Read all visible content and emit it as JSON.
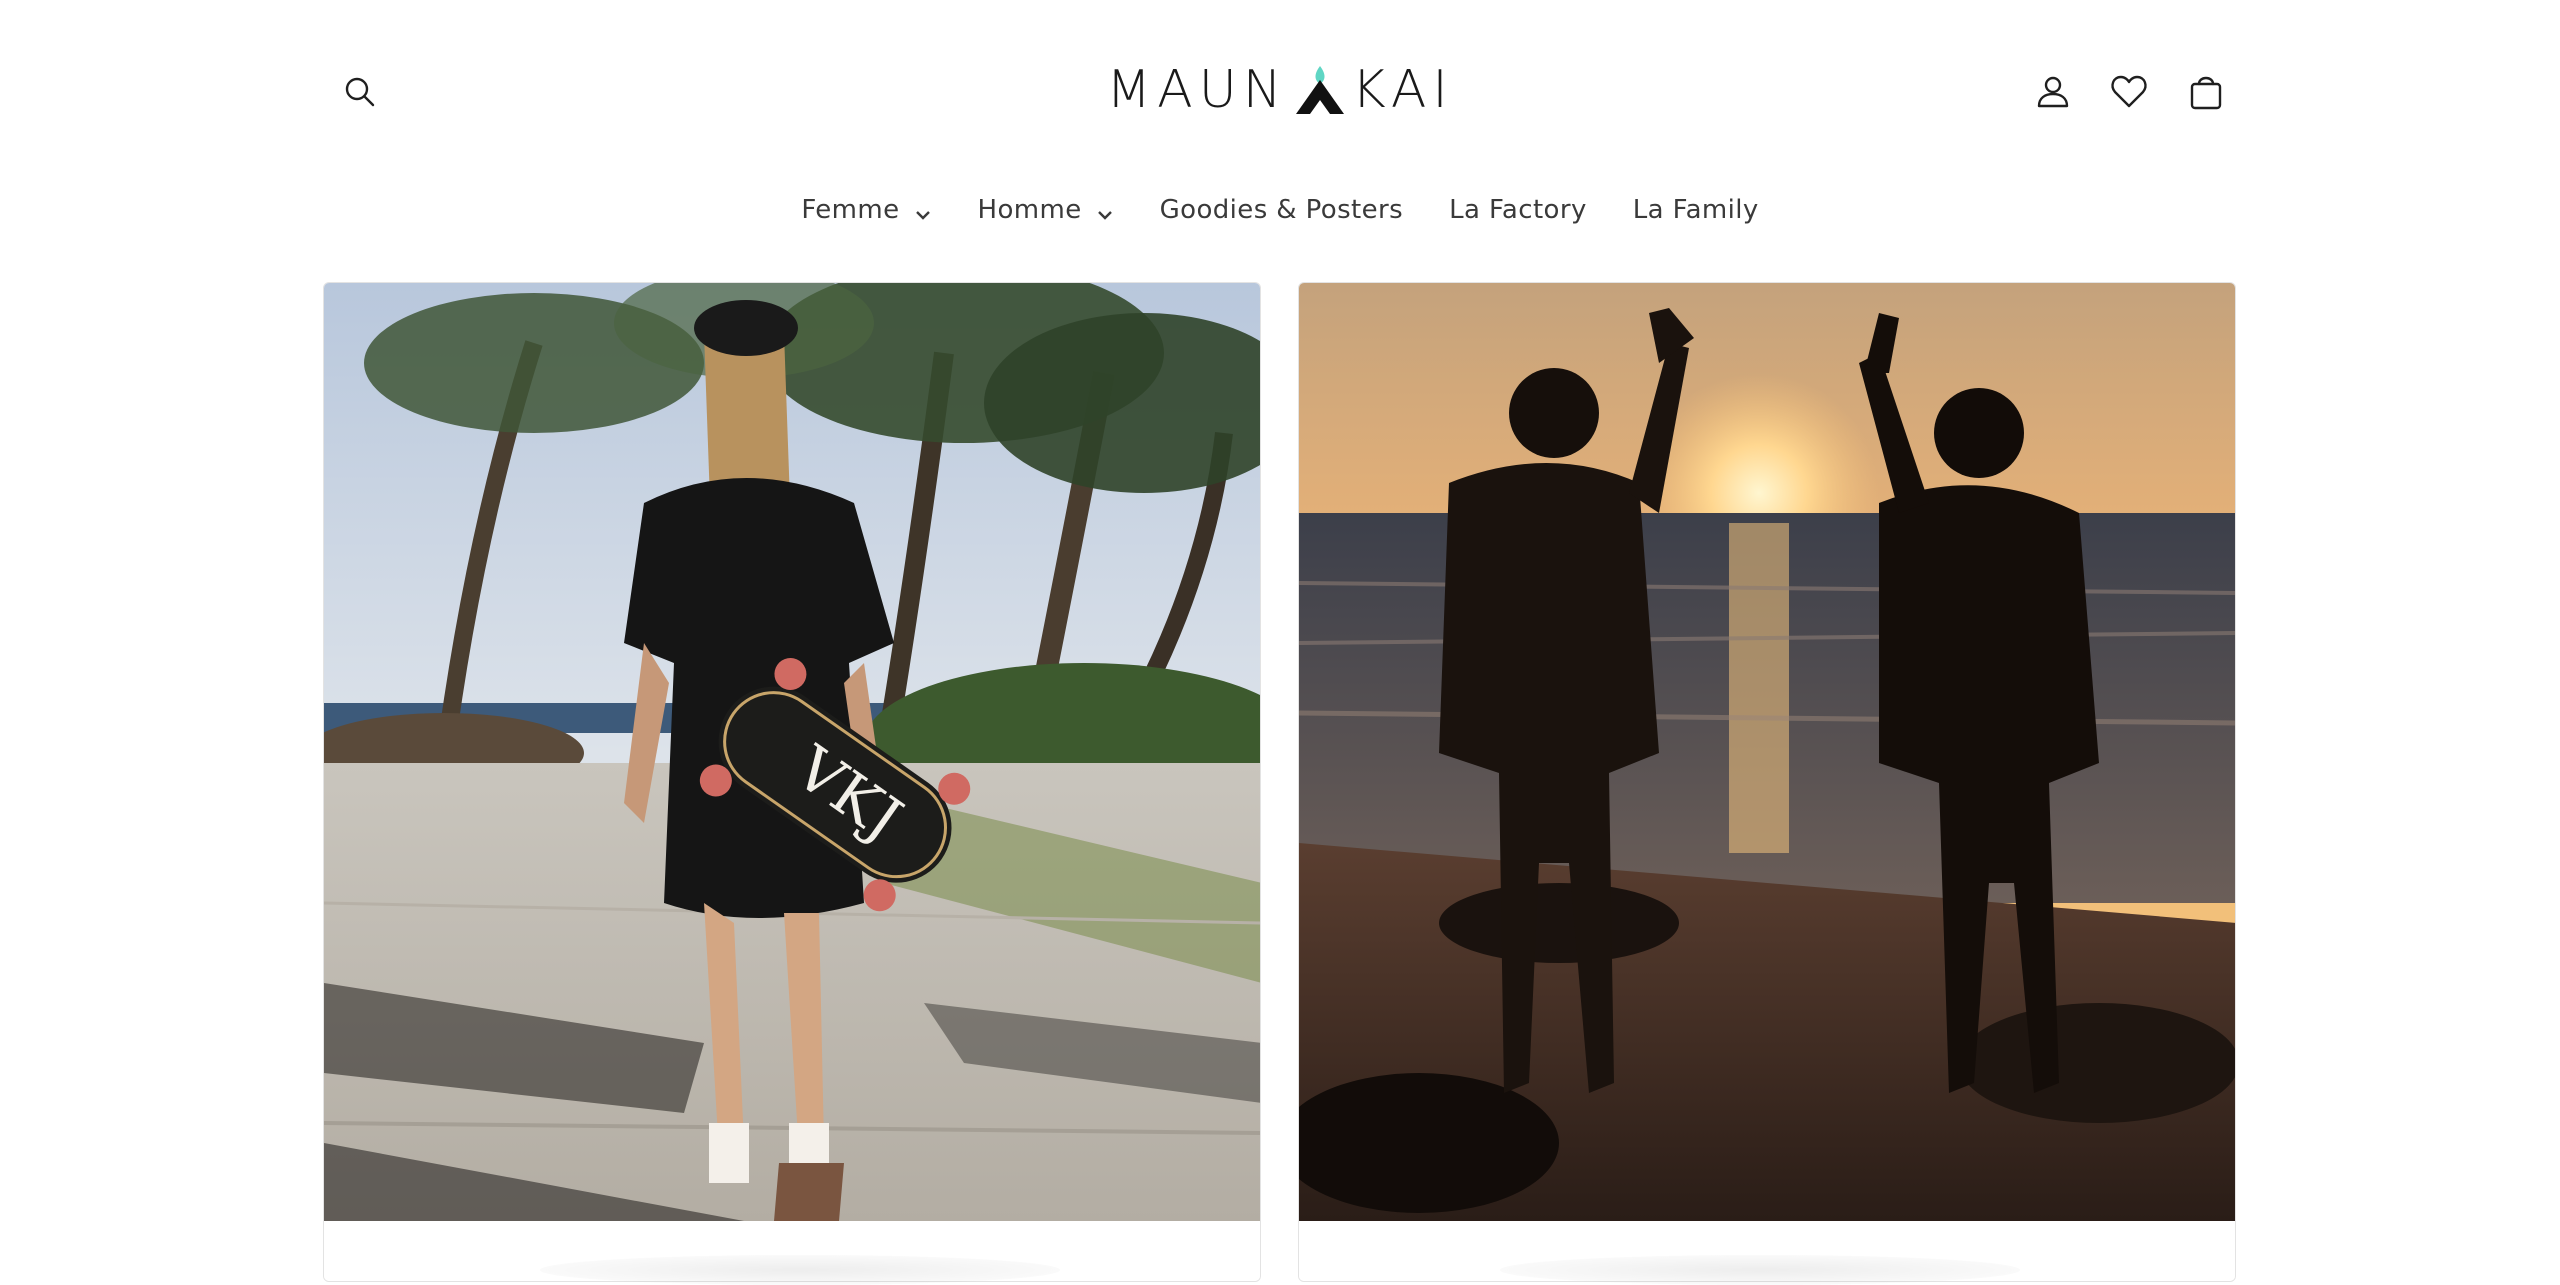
{
  "header": {
    "logo_text_left": "MAUN",
    "logo_text_right": "KAI",
    "icons": {
      "search": "search-icon",
      "account": "user-icon",
      "wishlist": "heart-icon",
      "cart": "bag-icon"
    }
  },
  "nav": {
    "items": [
      {
        "label": "Femme",
        "dropdown": true
      },
      {
        "label": "Homme",
        "dropdown": true
      },
      {
        "label": "Goodies & Posters",
        "dropdown": false
      },
      {
        "label": "La Factory",
        "dropdown": false
      },
      {
        "label": "La Family",
        "dropdown": false
      }
    ]
  },
  "cards": [
    {
      "image": "woman-skateboard-palm-trees"
    },
    {
      "image": "two-men-high-five-sunset-beach"
    }
  ],
  "colors": {
    "logo_accent": "#5fd6c4",
    "text": "#3a3a3a"
  }
}
